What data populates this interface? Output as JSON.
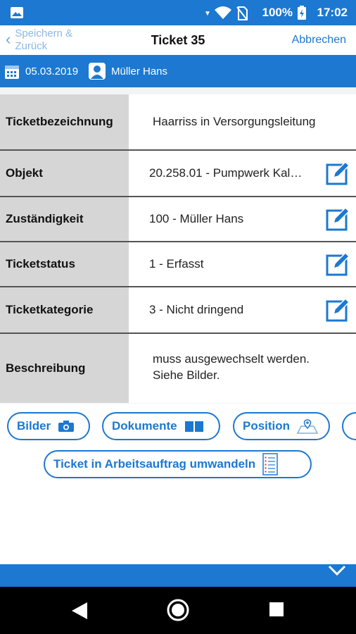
{
  "status_bar": {
    "battery": "100%",
    "time": "17:02"
  },
  "nav": {
    "back_label": "Speichern & Zurück",
    "title": "Ticket 35",
    "cancel_label": "Abbrechen"
  },
  "info": {
    "date": "05.03.2019",
    "user": "Müller Hans"
  },
  "fields": [
    {
      "label": "Ticketbezeichnung",
      "value": "Haarriss in Versorgungsleitung"
    },
    {
      "label": "Objekt",
      "value": "20.258.01 - Pumpwerk Kal…"
    },
    {
      "label": "Zuständigkeit",
      "value": "100 - Müller Hans"
    },
    {
      "label": "Ticketstatus",
      "value": "1 - Erfasst"
    },
    {
      "label": "Ticketkategorie",
      "value": "3 - Nicht dringend"
    },
    {
      "label": "Beschreibung",
      "value": "muss ausgewechselt werden.\nSiehe Bilder."
    }
  ],
  "actions": {
    "bilder": "Bilder",
    "dokumente": "Dokumente",
    "position": "Position",
    "convert": "Ticket in Arbeitsauftrag umwandeln"
  },
  "colors": {
    "accent": "#1c78d0",
    "label_bg": "#d6d6d6"
  },
  "icons": [
    "image-icon",
    "wifi-icon",
    "battery-icon",
    "calendar-icon",
    "user-icon",
    "edit-icon",
    "camera-icon",
    "book-icon",
    "map-icon",
    "clipboard-icon",
    "chevron-down-icon"
  ]
}
